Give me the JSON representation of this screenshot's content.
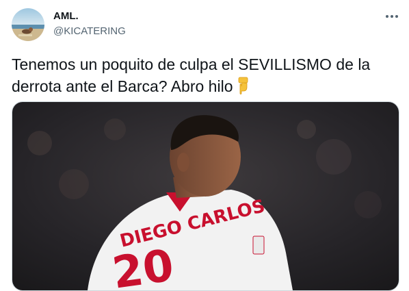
{
  "tweet": {
    "author": {
      "display_name": "AML.",
      "handle": "@KICATERING",
      "avatar": "beach-sunset-avatar"
    },
    "menu_icon": "more-horizontal-icon",
    "text": "Tenemos un poquito de culpa el SEVILLISMO de la derrota ante el Barca? Abro hilo",
    "emoji": "backhand-index-pointing-down",
    "media": {
      "description_icon": "photo",
      "jersey_name": "DIEGO CARLOS",
      "jersey_number": "20"
    }
  },
  "colors": {
    "text_primary": "#0f1419",
    "text_secondary": "#536471",
    "border": "#cfd9de",
    "jersey_red": "#c8102e"
  }
}
